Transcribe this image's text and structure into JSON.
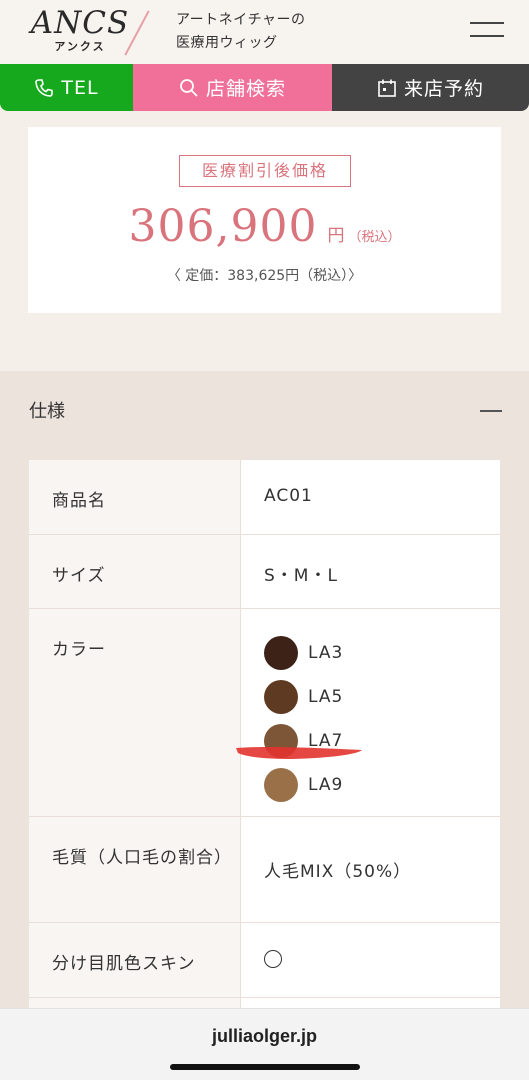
{
  "header": {
    "logo_main": "ANCS",
    "logo_sub": "アンクス",
    "tagline_line1": "アートネイチャーの",
    "tagline_line2": "医療用ウィッグ"
  },
  "nav": {
    "tel_label": "TEL",
    "search_label": "店舗検索",
    "visit_label": "来店予約"
  },
  "price": {
    "badge": "医療割引後価格",
    "amount": "306,900",
    "unit": "円",
    "tax": "（税込）",
    "regular": "〈 定価：383,625円（税込）〉"
  },
  "spec": {
    "title": "仕様",
    "rows": {
      "product_name": {
        "label": "商品名",
        "value": "AC01"
      },
      "size": {
        "label": "サイズ",
        "value": "S・M・L"
      },
      "color": {
        "label": "カラー",
        "options": [
          {
            "name": "LA3",
            "color": "#3d2218"
          },
          {
            "name": "LA5",
            "color": "#5e3a22"
          },
          {
            "name": "LA7",
            "color": "#7c5636"
          },
          {
            "name": "LA9",
            "color": "#9a7048"
          }
        ]
      },
      "hair_quality": {
        "label": "毛質（人口毛の割合）",
        "value": "人毛MIX（50%）"
      },
      "parting": {
        "label": "分け目肌色スキン",
        "value": "○"
      }
    }
  },
  "browser": {
    "url": "julliaolger.jp"
  },
  "colors": {
    "accent_pink": "#d9737c",
    "tel_green": "#16a91e",
    "search_pink": "#f0709a",
    "visit_dark": "#434343"
  }
}
